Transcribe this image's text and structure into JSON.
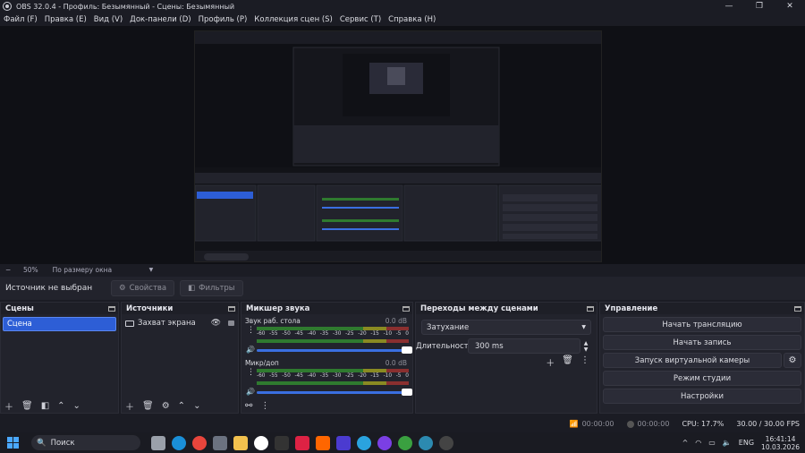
{
  "window": {
    "title": "OBS 32.0.4 - Профиль: Безымянный - Сцены: Безымянный"
  },
  "menu": [
    "Файл (F)",
    "Правка (E)",
    "Вид (V)",
    "Док-панели (D)",
    "Профиль (P)",
    "Коллекция сцен (S)",
    "Сервис (T)",
    "Справка (H)"
  ],
  "preview_bar": {
    "minus": "−",
    "zoom": "50%",
    "fit": "По размеру окна"
  },
  "context": {
    "no_source": "Источник не выбран",
    "properties": "Свойства",
    "filters": "Фильтры"
  },
  "docks": {
    "scenes": {
      "title": "Сцены",
      "items": [
        "Сцена"
      ]
    },
    "sources": {
      "title": "Источники",
      "items": [
        "Захват экрана"
      ]
    },
    "mixer": {
      "title": "Микшер звука",
      "channels": [
        {
          "name": "Звук раб. стола",
          "db": "0.0 dB"
        },
        {
          "name": "Микр/доп",
          "db": "0.0 dB"
        }
      ],
      "ticks": [
        "-60",
        "-55",
        "-50",
        "-45",
        "-40",
        "-35",
        "-30",
        "-25",
        "-20",
        "-15",
        "-10",
        "-5",
        "0"
      ]
    },
    "transitions": {
      "title": "Переходы между сценами",
      "selected": "Затухание",
      "duration_label": "Длительность",
      "duration_value": "300 ms"
    },
    "controls": {
      "title": "Управление",
      "start_stream": "Начать трансляцию",
      "start_record": "Начать запись",
      "virtual_cam": "Запуск виртуальной камеры",
      "studio_mode": "Режим студии",
      "settings": "Настройки"
    }
  },
  "status": {
    "stream_time": "00:00:00",
    "rec_time": "00:00:00",
    "cpu": "CPU: 17.7%",
    "fps": "30.00 / 30.00 FPS"
  },
  "taskbar": {
    "search": "Поиск",
    "lang": "ENG",
    "time": "16:41:14",
    "date": "10.03.2026"
  }
}
